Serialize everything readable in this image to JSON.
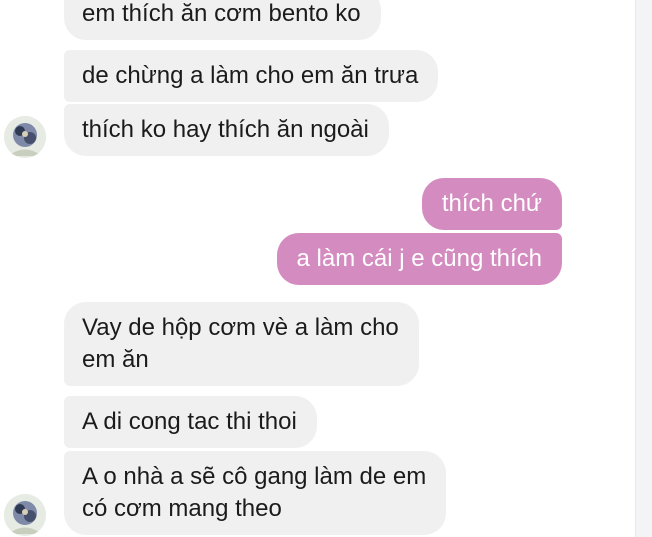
{
  "conversation": {
    "messages": [
      {
        "sender": "other",
        "text": "em thích ăn cơm bento ko"
      },
      {
        "sender": "other",
        "text": "de chừng a làm cho em ăn trưa"
      },
      {
        "sender": "other",
        "text": "thích ko hay thích ăn ngoài"
      },
      {
        "sender": "me",
        "text": "thích chứ"
      },
      {
        "sender": "me",
        "text": "a làm cái j e cũng thích"
      },
      {
        "sender": "other",
        "lines": [
          "Vay de hộp cơm vè a làm cho",
          "em ăn"
        ]
      },
      {
        "sender": "other",
        "text": "A di cong tac thi thoi"
      },
      {
        "sender": "other",
        "lines": [
          "A o nhà a sẽ cô gang làm de em",
          "có cơm mang theo"
        ]
      }
    ]
  },
  "colors": {
    "incoming_bubble": "#f1f0f0",
    "outgoing_bubble": "#d48bbf",
    "outgoing_text": "#ffffff",
    "incoming_text": "#1b1b1b"
  },
  "icons": {
    "avatar": "contact-avatar-icon"
  }
}
